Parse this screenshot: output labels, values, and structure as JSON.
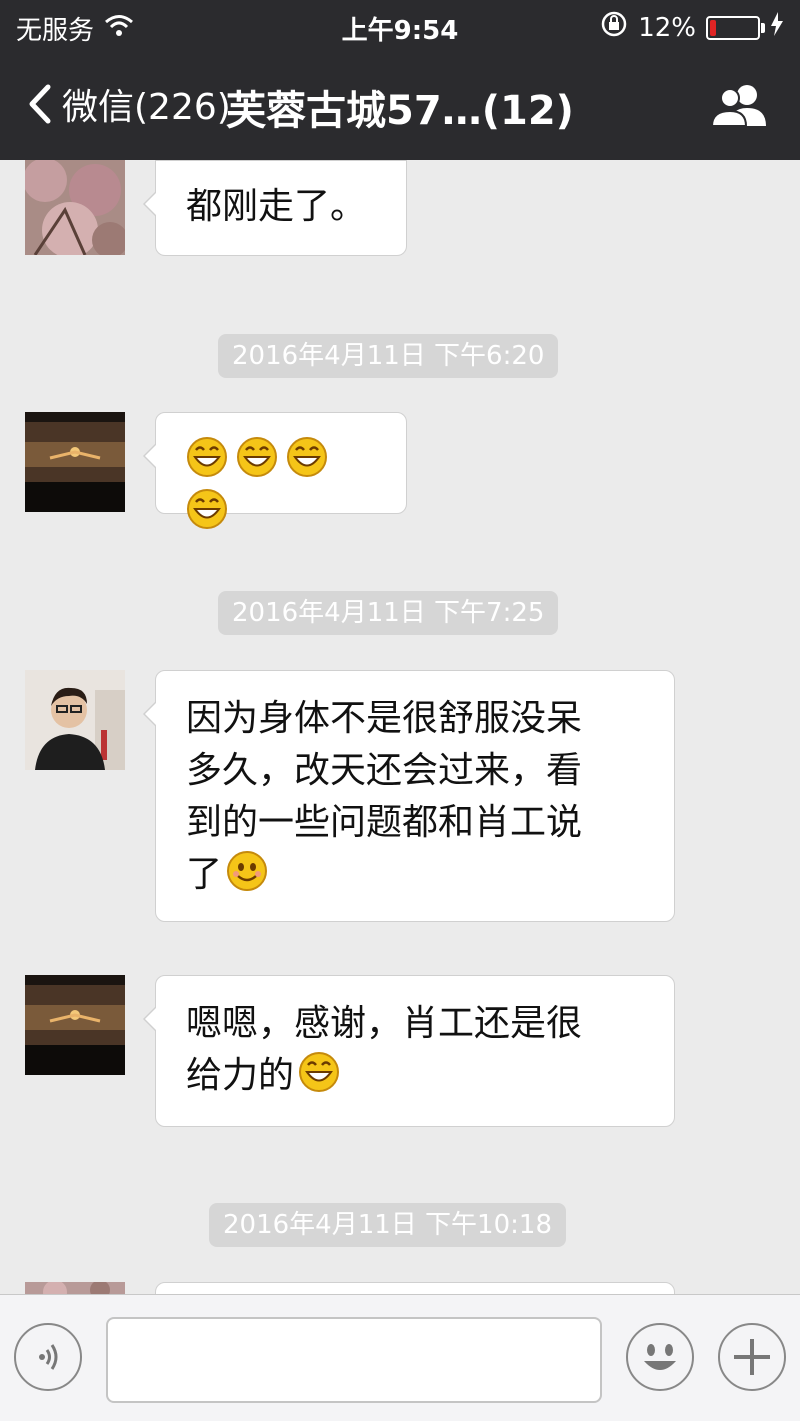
{
  "status_bar": {
    "carrier": "无服务",
    "time": "上午9:54",
    "battery_percent": "12%",
    "battery_level": 0.12
  },
  "nav": {
    "back_label": "微信(226)",
    "title": "芙蓉古城57…(12)"
  },
  "messages": [
    {
      "text": "都刚走了。"
    },
    {
      "timestamp": "2016年4月11日 下午6:20"
    },
    {
      "emojis": [
        "grin",
        "grin",
        "grin",
        "grin"
      ]
    },
    {
      "timestamp": "2016年4月11日 下午7:25"
    },
    {
      "lines": [
        "因为身体不是很舒服没呆",
        "多久，改天还会过来，看",
        "到的一些问题都和肖工说",
        "了"
      ],
      "trailing_emoji": "smile"
    },
    {
      "lines": [
        "嗯嗯，感谢，肖工还是很",
        "给力的"
      ],
      "trailing_emoji": "grin"
    },
    {
      "timestamp": "2016年4月11日 下午10:18"
    }
  ],
  "colors": {
    "nav_bg": "#2b2b2e",
    "chat_bg": "#ebebeb",
    "battery_low": "#e02424",
    "emoji_yellow": "#f5c518"
  }
}
